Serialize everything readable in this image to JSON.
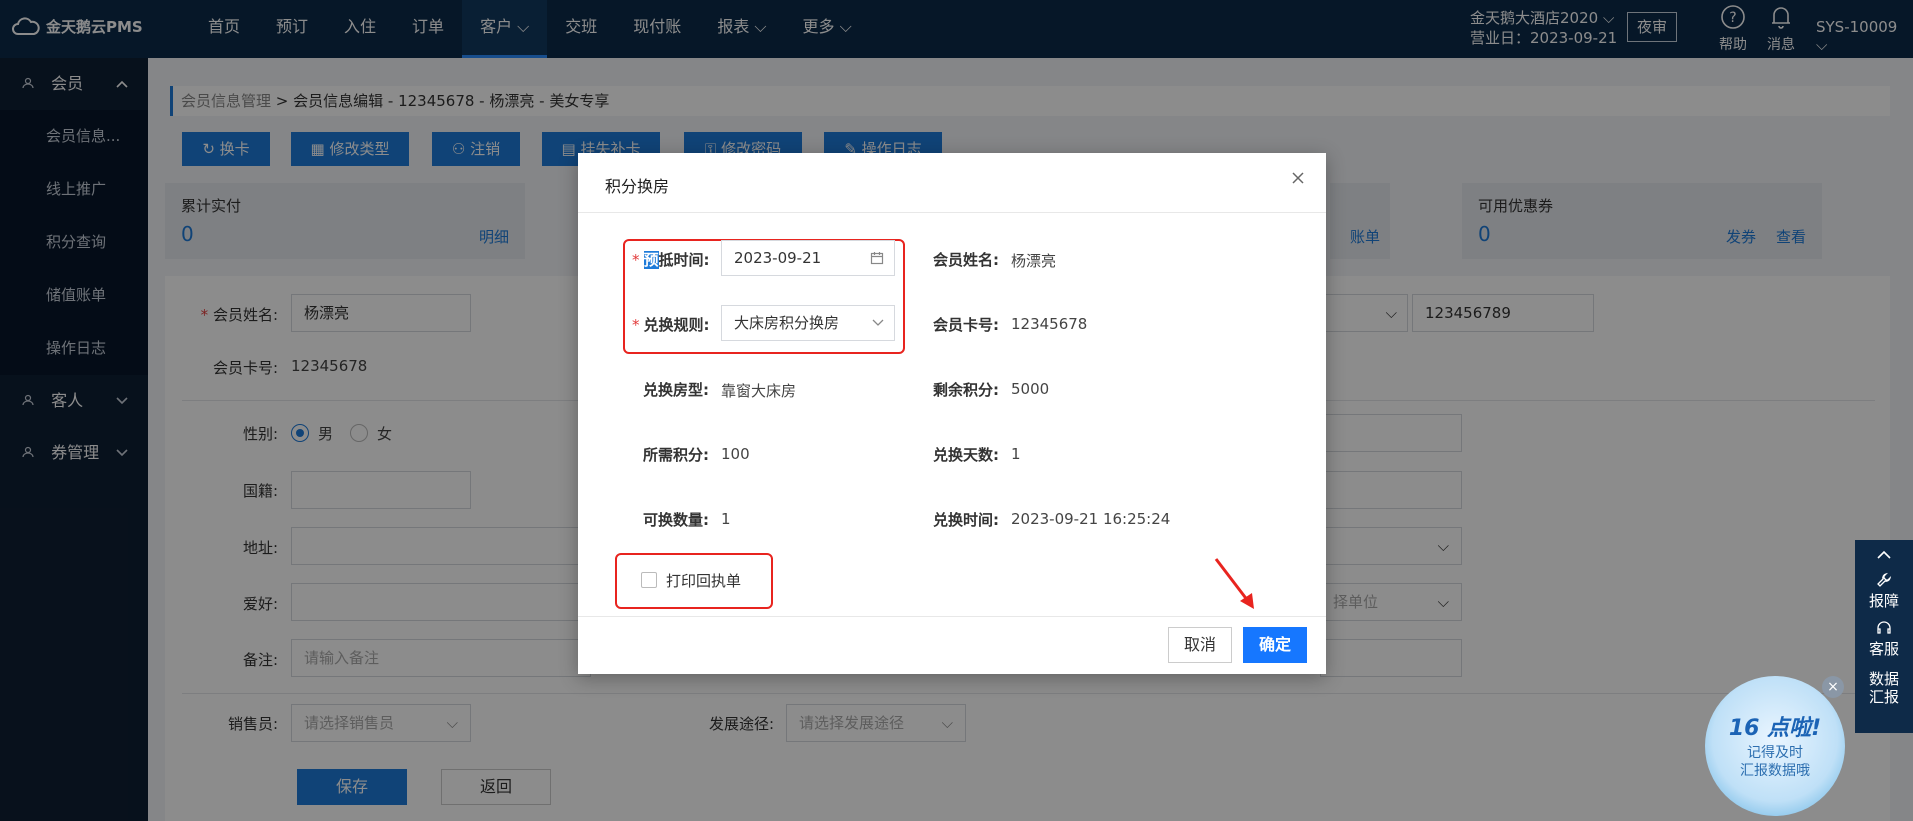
{
  "app": {
    "logo_text": "金天鹅云PMS",
    "nav": [
      "首页",
      "预订",
      "入住",
      "订单",
      "客户 ⌵",
      "交班",
      "现付账",
      "报表 ⌵",
      "更多 ⌵"
    ],
    "hotel_name": "金天鹅大酒店2020 ⌵",
    "business_date": "营业日：2023-09-21",
    "night_audit": "夜审",
    "help": "帮助",
    "messages": "消息",
    "sys_id": "SYS-10009 ⌵"
  },
  "sidebar": {
    "groups": [
      {
        "label": "会员",
        "items": [
          "会员信息...",
          "线上推广",
          "积分查询",
          "储值账单",
          "操作日志"
        ]
      },
      {
        "label": "客人"
      },
      {
        "label": "券管理"
      }
    ]
  },
  "page": {
    "breadcrumb_parent": "会员信息管理",
    "breadcrumb_current": " > 会员信息编辑 - 12345678 - 杨漂亮 - 美女专享",
    "toolbar": [
      "换卡",
      "修改类型",
      "注销",
      "挂失补卡",
      "修改密码",
      "操作日志"
    ],
    "stats": {
      "total_paid_label": "累计实付",
      "total_paid_value": "0",
      "total_paid_link": "明细",
      "bill_link": "账单",
      "coupon_label": "可用优惠券",
      "coupon_value": "0",
      "coupon_issue": "发券",
      "coupon_view": "查看"
    },
    "form": {
      "name_label": "会员姓名:",
      "name_value": "杨漂亮",
      "card_label": "会员卡号:",
      "card_value": "12345678",
      "id_value": "123456789",
      "gender_label": "性别:",
      "gender_male": "男",
      "gender_female": "女",
      "nationality_label": "国籍:",
      "address_label": "地址:",
      "hobby_label": "爱好:",
      "note_label": "备注:",
      "note_placeholder": "请输入备注",
      "unit_placeholder": "择单位",
      "sales_label": "销售员:",
      "sales_placeholder": "请选择销售员",
      "channel_label": "发展途径:",
      "channel_placeholder": "请选择发展途径",
      "save": "保存",
      "back": "返回"
    }
  },
  "dialog": {
    "title": "积分换房",
    "checkin_label_sel": "预",
    "checkin_label_rest": "抵时间:",
    "checkin_value": "2023-09-21",
    "rule_label": "兑换规则:",
    "rule_value": "大床房积分换房",
    "member_name_label": "会员姓名:",
    "member_name_value": "杨漂亮",
    "card_label": "会员卡号:",
    "card_value": "12345678",
    "room_type_label": "兑换房型:",
    "room_type_value": "靠窗大床房",
    "remain_points_label": "剩余积分:",
    "remain_points_value": "5000",
    "need_points_label": "所需积分:",
    "need_points_value": "100",
    "days_label": "兑换天数:",
    "days_value": "1",
    "qty_label": "可换数量:",
    "qty_value": "1",
    "time_label": "兑换时间:",
    "time_value": "2023-09-21 16:25:24",
    "print_receipt": "打印回执单",
    "cancel": "取消",
    "ok": "确定"
  },
  "side_tools": {
    "report_fault": "报障",
    "service": "客服",
    "data_report_1": "数据",
    "data_report_2": "汇报"
  },
  "promo": {
    "title": "16 点啦!",
    "line1": "记得及时",
    "line2": "汇报数据哦"
  }
}
